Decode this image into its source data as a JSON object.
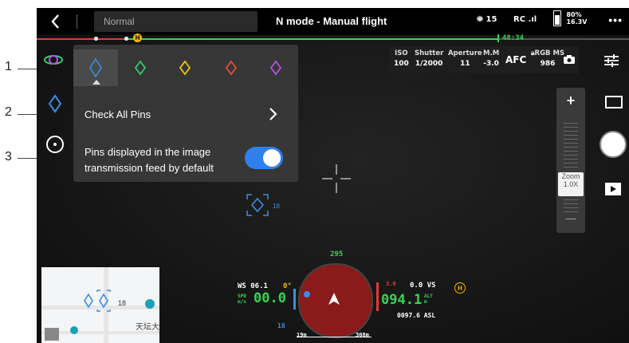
{
  "callouts": [
    "1",
    "2",
    "3"
  ],
  "topbar": {
    "mode_value": "Normal",
    "title": "N mode - Manual flight",
    "satellites": "15",
    "rc_signal": "RC",
    "battery_percent": "80%",
    "battery_voltage": "16.3V",
    "more": "•••",
    "flight_time": "48:34",
    "home_marker": "H"
  },
  "pin_panel": {
    "pins": [
      {
        "icon": "blue-diamond-pin-icon",
        "color": "#3a8ee6",
        "selected": true
      },
      {
        "icon": "green-diamond-pin-icon",
        "color": "#2ecc71"
      },
      {
        "icon": "yellow-diamond-pin-icon",
        "color": "#f1c40f"
      },
      {
        "icon": "red-diamond-pin-icon",
        "color": "#e74c3c"
      },
      {
        "icon": "purple-diamond-pin-icon",
        "color": "#b455e0"
      }
    ],
    "check_all_pins": "Check All Pins",
    "default_display_line1": "Pins displayed in the image",
    "default_display_line2": "transmission feed by default",
    "toggle_on": true
  },
  "camera": {
    "iso_label": "ISO",
    "iso_value": "100",
    "shutter_label": "Shutter",
    "shutter_value": "1/2000",
    "aperture_label": "Aperture",
    "aperture_value": "11",
    "mm_label": "M.M",
    "mm_value": "-3.0",
    "afc": "AFC",
    "rgb_label": "RGB MS",
    "rgb_value": "986"
  },
  "zoom": {
    "label": "Zoom",
    "value": "1.0X",
    "plus": "+",
    "minus": "—"
  },
  "pin_marker_distance": "18",
  "map": {
    "distance": "18",
    "place": "天坛大"
  },
  "nav": {
    "heading": "295",
    "ws": "WS 06.1",
    "ws_angle": "0°",
    "spd_label1": "SPD",
    "spd_label2": "m/s",
    "speed": "00.0",
    "alt": "094.1",
    "alt_label1": "ALT",
    "alt_label2": "m",
    "vs": "0.0 VS",
    "vs_small": "3.0",
    "asl": "0097.6 ASL",
    "bottom_left": "18",
    "dist1": "19m",
    "dist2": "308m",
    "home": "H",
    "colors": {
      "compass": "#8b1a1a",
      "green": "#39d353",
      "yellow": "#f5b800",
      "red": "#e53935"
    }
  }
}
